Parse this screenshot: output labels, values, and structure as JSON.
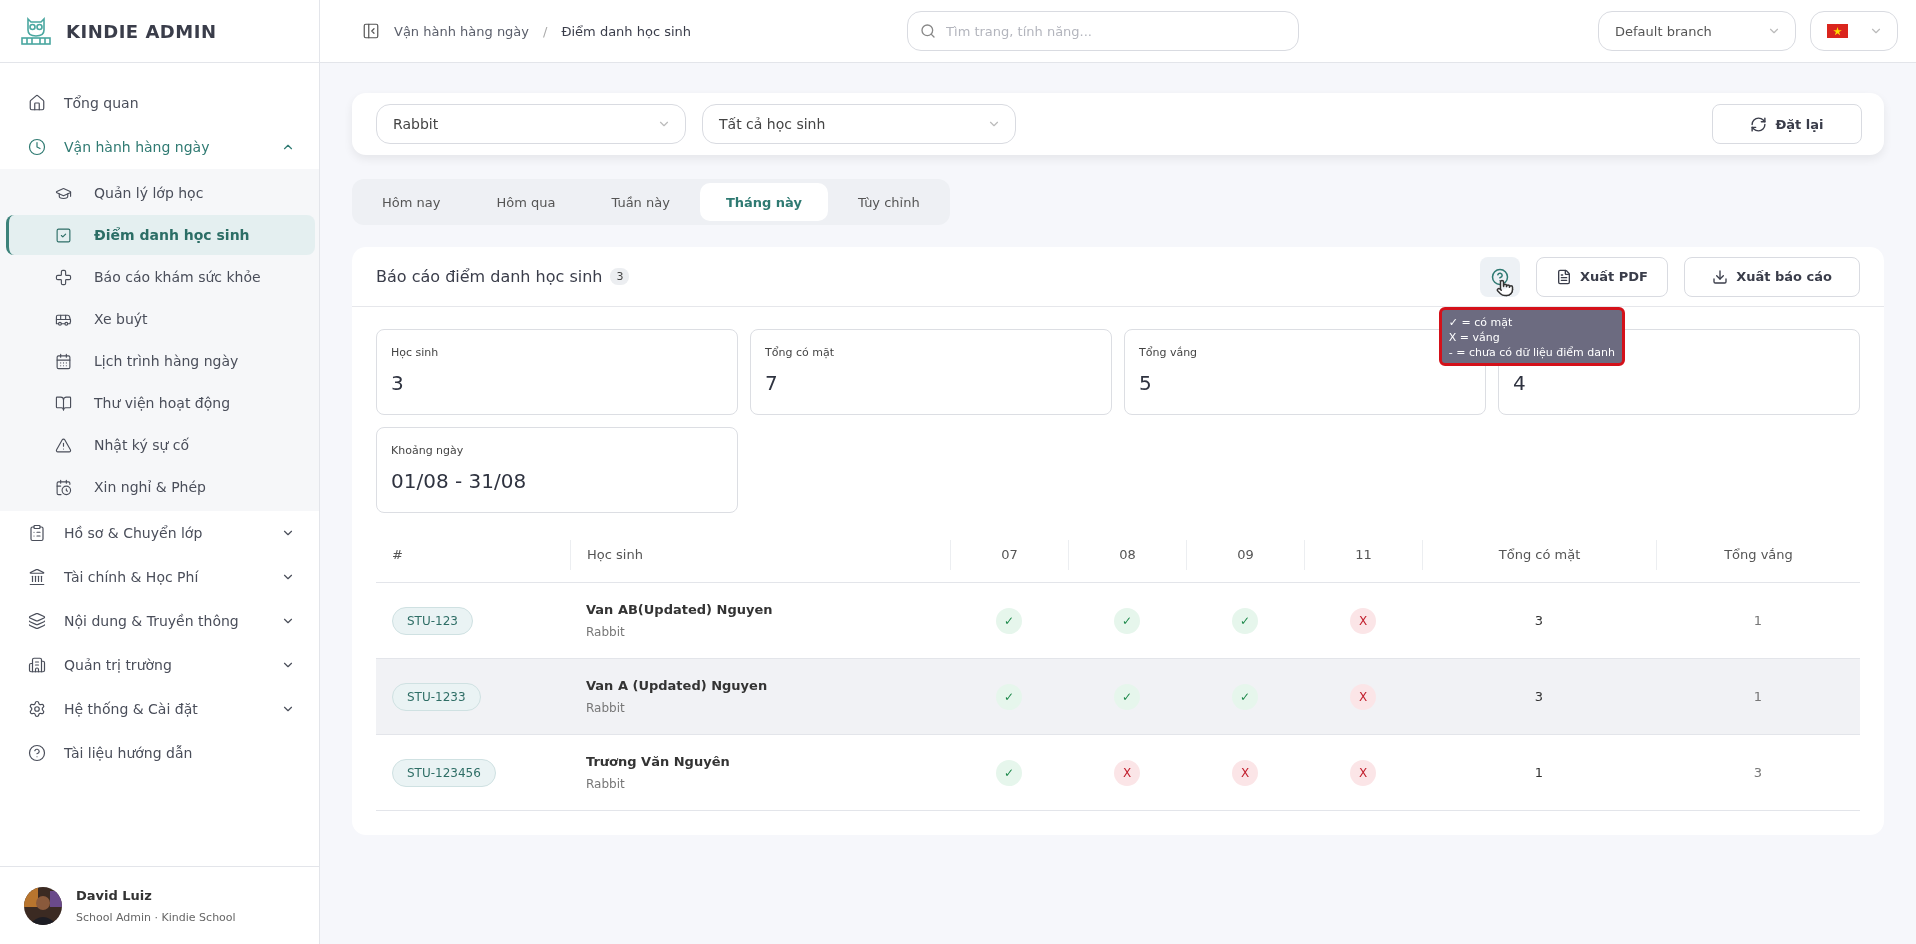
{
  "brand": {
    "name": "KINDIE ADMIN"
  },
  "sidebar": {
    "items": [
      {
        "kind": "link",
        "label": "Tổng quan"
      },
      {
        "kind": "group",
        "label": "Vận hành hàng ngày",
        "expanded": true,
        "children": [
          {
            "label": "Quản lý lớp học",
            "selected": false
          },
          {
            "label": "Điểm danh học sinh",
            "selected": true
          },
          {
            "label": "Báo cáo khám sức khỏe",
            "selected": false
          },
          {
            "label": "Xe buýt",
            "selected": false
          },
          {
            "label": "Lịch trình hàng ngày",
            "selected": false
          },
          {
            "label": "Thư viện hoạt động",
            "selected": false
          },
          {
            "label": "Nhật ký sự cố",
            "selected": false
          },
          {
            "label": "Xin nghỉ & Phép",
            "selected": false
          }
        ]
      },
      {
        "kind": "group",
        "label": "Hồ sơ & Chuyển lớp",
        "expanded": false
      },
      {
        "kind": "group",
        "label": "Tài chính & Học Phí",
        "expanded": false
      },
      {
        "kind": "group",
        "label": "Nội dung & Truyền thông",
        "expanded": false
      },
      {
        "kind": "group",
        "label": "Quản trị trường",
        "expanded": false
      },
      {
        "kind": "group",
        "label": "Hệ thống & Cài đặt",
        "expanded": false
      },
      {
        "kind": "link",
        "label": "Tài liệu hướng dẫn"
      }
    ],
    "user": {
      "name": "David Luiz",
      "role": "School Admin · Kindie School"
    }
  },
  "topbar": {
    "breadcrumb_separator": "/",
    "breadcrumb": [
      "Vận hành hàng ngày",
      "Điểm danh học sinh"
    ],
    "search": {
      "placeholder": "Tìm trang, tính năng..."
    },
    "branch": "Default branch"
  },
  "filters": {
    "class": "Rabbit",
    "students": "Tất cả học sinh",
    "reset": "Đặt lại"
  },
  "tabs": [
    {
      "label": "Hôm nay",
      "selected": false
    },
    {
      "label": "Hôm qua",
      "selected": false
    },
    {
      "label": "Tuần này",
      "selected": false
    },
    {
      "label": "Tháng này",
      "selected": true
    },
    {
      "label": "Tùy chỉnh",
      "selected": false
    }
  ],
  "report": {
    "title": "Báo cáo điểm danh học sinh",
    "count": "3",
    "export_pdf": "Xuất PDF",
    "export_report": "Xuất báo cáo",
    "tooltip": [
      "✓ = có mặt",
      "X = vắng",
      "- = chưa có dữ liệu điểm danh"
    ],
    "stats": [
      {
        "label": "Học sinh",
        "value": "3"
      },
      {
        "label": "Tổng có mặt",
        "value": "7"
      },
      {
        "label": "Tổng vắng",
        "value": "5"
      },
      {
        "value": "4"
      },
      {
        "label": "Khoảng ngày",
        "value": "01/08 - 31/08"
      }
    ],
    "table": {
      "columns": [
        "#",
        "Học sinh",
        "07",
        "08",
        "09",
        "11",
        "Tổng có mặt",
        "Tổng vắng"
      ],
      "rows": [
        {
          "id": "STU-123",
          "name": "Van AB(Updated) Nguyen",
          "class": "Rabbit",
          "highlighted": false,
          "days": [
            {
              "kind": "present",
              "mark": "✓"
            },
            {
              "kind": "present",
              "mark": "✓"
            },
            {
              "kind": "present",
              "mark": "✓"
            },
            {
              "kind": "absent",
              "mark": "X"
            }
          ],
          "present": "3",
          "absent": "1"
        },
        {
          "id": "STU-1233",
          "name": "Van A (Updated) Nguyen",
          "class": "Rabbit",
          "highlighted": true,
          "days": [
            {
              "kind": "present",
              "mark": "✓"
            },
            {
              "kind": "present",
              "mark": "✓"
            },
            {
              "kind": "present",
              "mark": "✓"
            },
            {
              "kind": "absent",
              "mark": "X"
            }
          ],
          "present": "3",
          "absent": "1"
        },
        {
          "id": "STU-123456",
          "name": "Trương Văn Nguyên",
          "class": "Rabbit",
          "highlighted": false,
          "days": [
            {
              "kind": "present",
              "mark": "✓"
            },
            {
              "kind": "absent",
              "mark": "X"
            },
            {
              "kind": "absent",
              "mark": "X"
            },
            {
              "kind": "absent",
              "mark": "X"
            }
          ],
          "present": "1",
          "absent": "3"
        }
      ]
    }
  }
}
